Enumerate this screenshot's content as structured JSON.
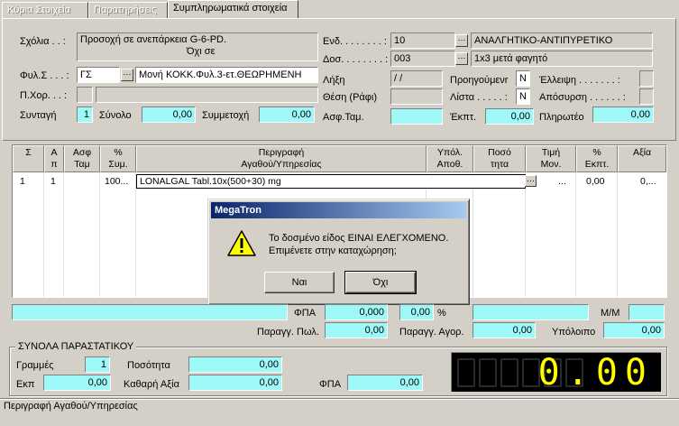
{
  "tabs": [
    {
      "label": "Κύρια Στοιχεία"
    },
    {
      "label": "Παρατηρήσεις"
    },
    {
      "label": "Συμπληρωματικά στοιχεία"
    }
  ],
  "header": {
    "sxolia_label": "Σχόλια . . :",
    "sxolia_line1": "Προσοχή σε ανεπάρκεια G-6-PD.",
    "sxolia_line2": "Όχι σε",
    "fyl_label": "Φυλ.Σ . . . :",
    "fyl_code": "ΓΣ",
    "fyl_desc": "Μονή ΚΟΚΚ.Φυλ.3-ετ.ΘΕΩΡΗΜΕΝΗ",
    "pxor_label": "Π.Χορ. . . :",
    "syntagi_label": "Συνταγή",
    "syntagi_value": "1",
    "synolo_label": "Σύνολο",
    "synolo_value": "0,00",
    "symmetoxi_label": "Συμμετοχή",
    "symmetoxi_value": "0,00",
    "end_label": "Ενδ. . . . . . . . :",
    "end_code": "10",
    "end_desc": "ΑΝΑΛΓΗΤΙΚΟ-ΑΝΤΙΠΥΡΕΤΙΚΟ",
    "dos_label": "Δοσ. . . . . . . . :",
    "dos_code": "003",
    "dos_desc": "1x3 μετά φαγητό",
    "lixi_label": "Λήξη",
    "lixi_value": "/ /",
    "thesi_label": "Θέση (Ράφι)",
    "asf_label": "Ασφ.Ταμ.",
    "proig_label": "Προηγούμενr",
    "proig_value": "N",
    "lista_label": "Λίστα . . . . . :",
    "lista_value": "N",
    "ekpt_label": "Έκπτ.",
    "ekpt_value": "0,00",
    "elleipsi_label": "Έλλειψη . . . . . . . :",
    "aposyrsi_label": "Απόσυρση . . . . . . :",
    "pliroteo_label": "Πληρωτέο",
    "pliroteo_value": "0,00"
  },
  "grid": {
    "columns": [
      {
        "line1": "Σ",
        "line2": ""
      },
      {
        "line1": "Α",
        "line2": "π"
      },
      {
        "line1": "Ασφ",
        "line2": "Ταμ"
      },
      {
        "line1": "%",
        "line2": "Συμ."
      },
      {
        "line1": "Περιγραφή",
        "line2": "Αγαθού/Υπηρεσίας"
      },
      {
        "line1": "Υπόλ.",
        "line2": "Αποθ."
      },
      {
        "line1": "Ποσό",
        "line2": "τητα"
      },
      {
        "line1": "Τιμή",
        "line2": "Μον."
      },
      {
        "line1": "%",
        "line2": "Εκπτ."
      },
      {
        "line1": "Αξία",
        "line2": ""
      }
    ],
    "row": {
      "s": "1",
      "ap": "1",
      "pct_sym": "100...",
      "desc": "LONALGAL Tabl.10x(500+30) mg",
      "timi": "...",
      "ekpt": "0,00",
      "axia": "0,..."
    }
  },
  "dialog": {
    "title": "MegaTron",
    "line1": "Το δοσμένο είδος ΕΙΝΑΙ ΕΛΕΓΧΟΜΕΝΟ.",
    "line2": "Επιμένετε στην καταχώρηση;",
    "yes": "Ναι",
    "no": "Όχι"
  },
  "lower": {
    "fpa_label": "ΦΠΑ",
    "fpa_value": "0,000",
    "fpa_pct": "0,00",
    "pct_sign": "%",
    "mm_label": "Μ/Μ",
    "parag_pol_label": "Παραγγ. Πωλ.",
    "parag_pol_value": "0,00",
    "parag_agor_label": "Παραγγ. Αγορ.",
    "parag_agor_value": "0,00",
    "ypoloipo_label": "Υπόλοιπο",
    "ypoloipo_value": "0,00"
  },
  "totals": {
    "title": "ΣΥΝΟΛΑ ΠΑΡΑΣΤΑΤΙΚΟΥ",
    "grammes_label": "Γραμμές",
    "grammes_value": "1",
    "posotita_label": "Ποσότητα",
    "posotita_value": "0,00",
    "ekp_label": "Εκπ",
    "ekp_value": "0,00",
    "kathari_label": "Καθαρή Αξία",
    "kathari_value": "0,00",
    "fpa_label": "ΦΠΑ",
    "fpa_value": "0,00",
    "display": "0.00",
    "display_color": "#ffff00"
  },
  "status": {
    "text": "Περιγραφή Αγαθού/Υπηρεσίας"
  }
}
